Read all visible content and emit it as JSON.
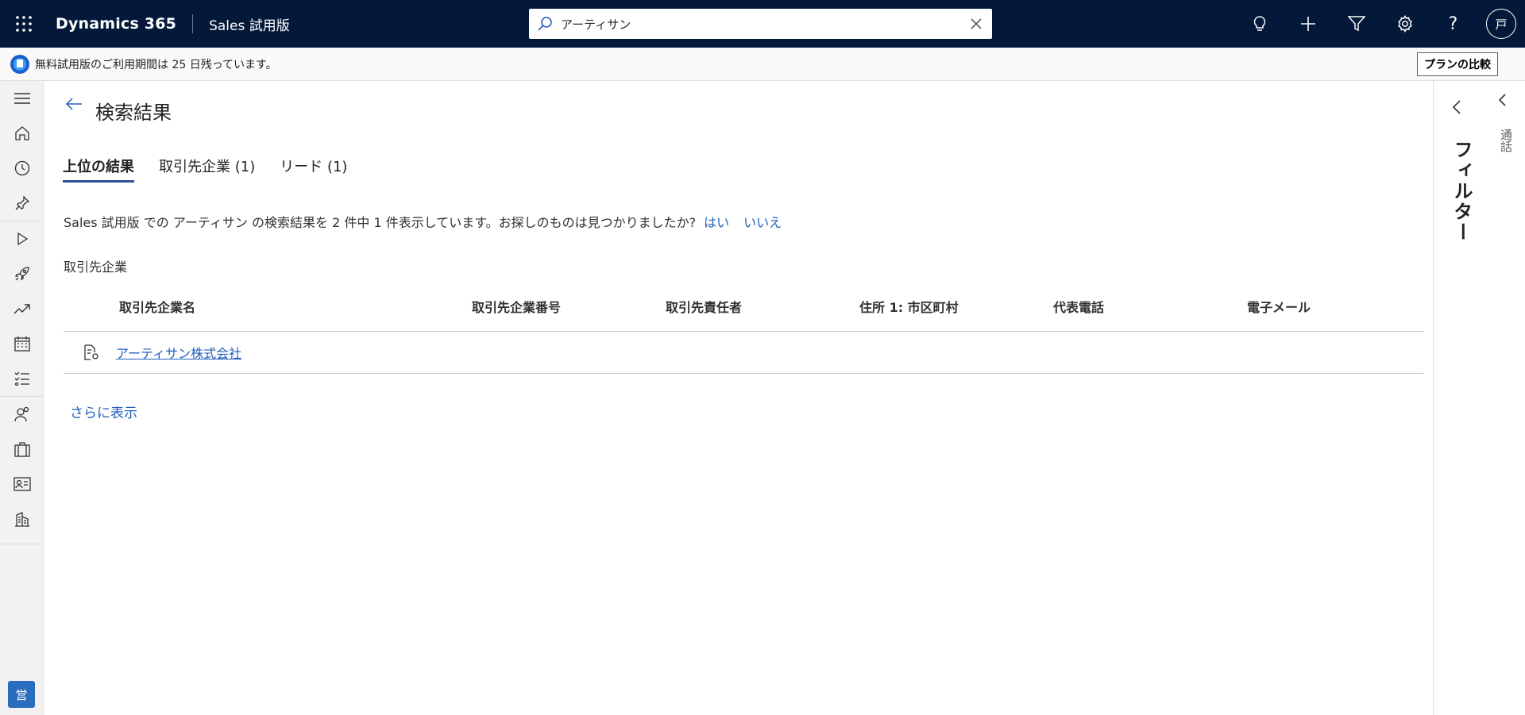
{
  "topbar": {
    "brand": "Dynamics 365",
    "app_name": "Sales 試用版",
    "search_value": "アーティサン",
    "avatar_initial": "戸",
    "icons": [
      "waffle-icon",
      "lightbulb-icon",
      "plus-icon",
      "filter-icon",
      "gear-icon",
      "help-icon"
    ]
  },
  "banner": {
    "text": "無料試用版のご利用期間は 25 日残っています。",
    "plan_button": "プランの比較"
  },
  "leftnav": {
    "items": [
      "menu-icon",
      "home-icon",
      "recent-icon",
      "pin-icon",
      "play-icon",
      "rocket-icon",
      "trend-icon",
      "calendar-icon",
      "tasks-icon",
      "contacts-icon",
      "briefcase-icon",
      "contact-card-icon",
      "building-icon"
    ],
    "area_label": "営"
  },
  "main": {
    "title": "検索結果",
    "tabs": [
      {
        "label": "上位の結果",
        "active": true
      },
      {
        "label": "取引先企業 (1)",
        "active": false
      },
      {
        "label": "リード (1)",
        "active": false
      }
    ],
    "result_text": "Sales 試用版 での アーティサン の検索結果を 2 件中 1 件表示しています。お探しのものは見つかりましたか?",
    "yes": "はい",
    "no": "いいえ",
    "section_label": "取引先企業",
    "grid": {
      "headers": [
        "取引先企業名",
        "取引先企業番号",
        "取引先責任者",
        "住所 1: 市区町村",
        "代表電話",
        "電子メール"
      ],
      "rows": [
        {
          "name": "アーティサン株式会社",
          "number": "",
          "contact": "",
          "city": "",
          "phone": "",
          "email": ""
        }
      ]
    },
    "show_more": "さらに表示"
  },
  "right": {
    "filter_label": "フィルター",
    "call_label": "通話"
  },
  "colors": {
    "topbar": "#04193a",
    "link": "#1f5fbf",
    "tab_underline": "#2f4f8f"
  }
}
